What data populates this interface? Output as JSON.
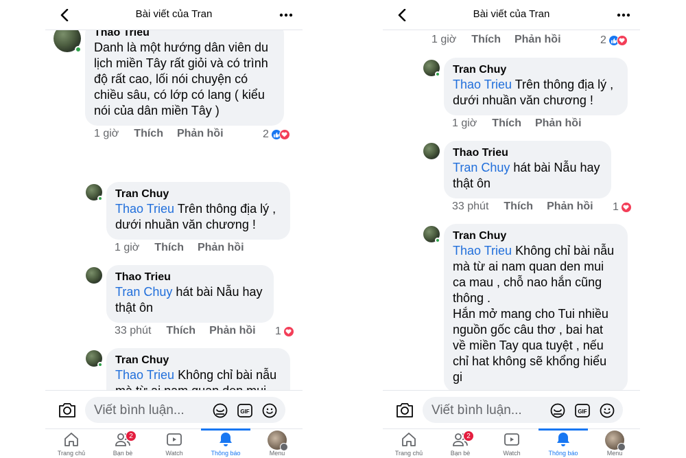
{
  "header": {
    "title": "Bài viết của Tran"
  },
  "comments": [
    {
      "author": "Thao Trieu",
      "mention": "",
      "text": "Danh là một hướng dân viên du lịch miền Tây rất giỏi và có trình độ rất cao, lối nói chuyện có chiều sâu, có lớp có lang ( kiểu nói của dân miền Tây )",
      "time": "1 giờ",
      "like_label": "Thích",
      "reply_label": "Phản hồi",
      "reaction_count": "2",
      "reactions": [
        "like",
        "love"
      ]
    },
    {
      "author": "Tran Chuy",
      "mention": "Thao Trieu",
      "text": "Trên thông địa lý , dưới nhuần văn chương !",
      "time": "1 giờ",
      "like_label": "Thích",
      "reply_label": "Phản hồi",
      "reaction_count": "",
      "reactions": []
    },
    {
      "author": "Thao Trieu",
      "mention": "Tran Chuy",
      "text": "hát bài Nẫu hay thật ôn",
      "time": "33 phút",
      "like_label": "Thích",
      "reply_label": "Phản hồi",
      "reaction_count": "1",
      "reactions": [
        "love"
      ]
    },
    {
      "author": "Tran Chuy",
      "mention": "Thao Trieu",
      "text": "Không chỉ bài nẫu mà từ ai nam quan den mui ca mau , chỗ nao hắn cũng thông .",
      "text2": "Hắn mở mang cho Tui nhiều nguồn gốc câu thơ , bai hat về miền Tay qua tuyệt , nếu chỉ hat không sẽ khổng hiểu gi",
      "time": "",
      "like_label": "",
      "reply_label": "",
      "reaction_count": "",
      "reactions": []
    }
  ],
  "composer": {
    "placeholder": "Viết bình luận..."
  },
  "tabs": [
    {
      "label": "Trang chủ",
      "icon": "home-icon"
    },
    {
      "label": "Bạn bè",
      "icon": "friends-icon",
      "badge": "2"
    },
    {
      "label": "Watch",
      "icon": "watch-icon"
    },
    {
      "label": "Thông báo",
      "icon": "bell-icon",
      "active": true
    },
    {
      "label": "Menu",
      "icon": "menu-avatar"
    }
  ],
  "colors": {
    "accent": "#1877f2",
    "mention": "#216fdb",
    "bubble": "#f0f2f5",
    "muted": "#65676b",
    "badge": "#e41e3f",
    "love": "#f33e58",
    "online": "#31a24c"
  }
}
